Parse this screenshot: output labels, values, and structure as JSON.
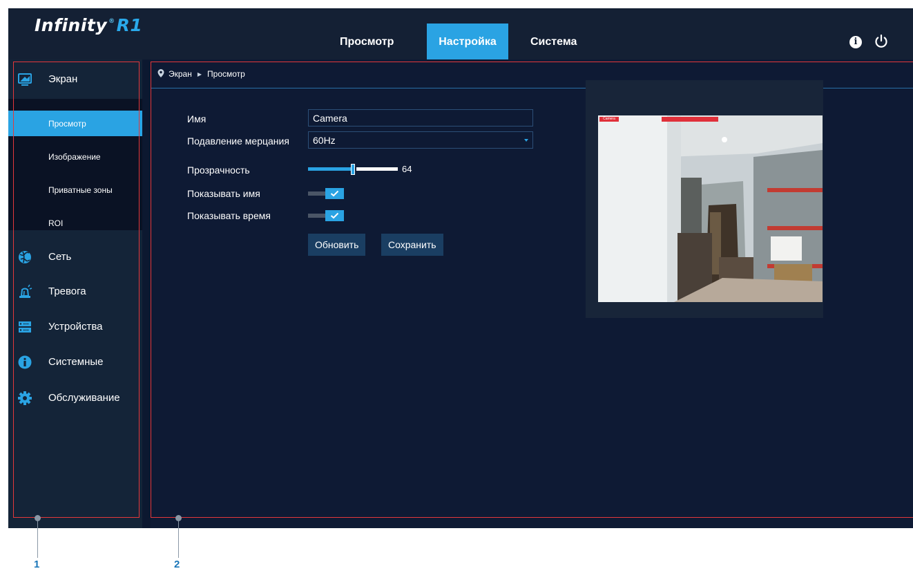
{
  "header": {
    "logo_text": "Infinity",
    "logo_reg": "®",
    "logo_model": "R1",
    "tabs": [
      {
        "label": "Просмотр",
        "active": false
      },
      {
        "label": "Настройка",
        "active": true
      },
      {
        "label": "Система",
        "active": false
      }
    ],
    "info_icon": "info-icon",
    "info_glyph": "i",
    "power_icon": "power-icon"
  },
  "sidebar": {
    "items": [
      {
        "label": "Экран",
        "icon": "monitor-icon",
        "expanded": true
      },
      {
        "label": "Сеть",
        "icon": "network-globe-icon"
      },
      {
        "label": "Тревога",
        "icon": "alarm-siren-icon"
      },
      {
        "label": "Устройства",
        "icon": "storage-device-icon"
      },
      {
        "label": "Системные",
        "icon": "info-icon"
      },
      {
        "label": "Обслуживание",
        "icon": "gear-icon"
      }
    ],
    "submenu": [
      {
        "label": "Просмотр",
        "active": true
      },
      {
        "label": "Изображение",
        "active": false
      },
      {
        "label": "Приватные зоны",
        "active": false
      },
      {
        "label": "ROI",
        "active": false
      }
    ]
  },
  "breadcrumb": {
    "icon": "location-pin-icon",
    "items": [
      "Экран",
      "Просмотр"
    ],
    "separator": "▶"
  },
  "form": {
    "name_label": "Имя",
    "name_value": "Camera",
    "flicker_label": "Подавление мерцания",
    "flicker_value": "60Hz",
    "transparency_label": "Прозрачность",
    "transparency_value": 64,
    "transparency_max": 128,
    "show_name_label": "Показывать имя",
    "show_name_checked": true,
    "show_time_label": "Показывать время",
    "show_time_checked": true
  },
  "buttons": {
    "refresh": "Обновить",
    "save": "Сохранить"
  },
  "callouts": [
    "1",
    "2"
  ],
  "colors": {
    "accent": "#2aa3e3",
    "header_bg": "#142034",
    "main_bg": "#0e1a34",
    "outline": "#e5383b",
    "callout_number": "#1a76b8"
  }
}
